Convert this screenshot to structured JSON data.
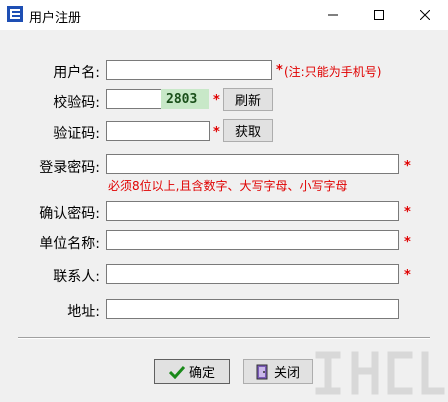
{
  "window": {
    "title": "用户注册",
    "minimize_icon": "minimize-icon",
    "maximize_icon": "maximize-icon",
    "close_icon": "close-icon"
  },
  "form": {
    "username": {
      "label": "用户名:",
      "value": "",
      "note": "(注:只能为手机号)"
    },
    "check_code": {
      "label": "校验码:",
      "value": "",
      "captcha": "2803",
      "refresh_label": "刷新"
    },
    "verify_code": {
      "label": "验证码:",
      "value": "",
      "get_label": "获取"
    },
    "password": {
      "label": "登录密码:",
      "value": "",
      "hint": "必须8位以上,且含数字、大写字母、小写字母"
    },
    "confirm_password": {
      "label": "确认密码:",
      "value": ""
    },
    "company": {
      "label": "单位名称:",
      "value": ""
    },
    "contact": {
      "label": "联系人:",
      "value": ""
    },
    "address": {
      "label": "地址:",
      "value": ""
    },
    "required_mark": "*"
  },
  "buttons": {
    "ok_label": "确定",
    "close_label": "关闭"
  },
  "colors": {
    "required": "#e00000",
    "captcha_bg": "#c8e8c8",
    "check_icon": "#1a8a1a"
  }
}
